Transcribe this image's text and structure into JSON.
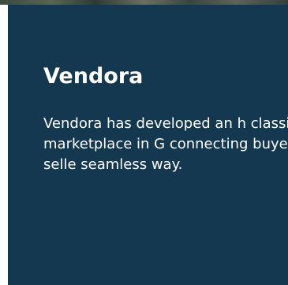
{
  "card": {
    "title": "Vendora",
    "description": "Vendora has developed an h classifieds marketplace in G connecting buyers and selle seamless way."
  },
  "colors": {
    "card_background": "#14384f",
    "text": "#ffffff"
  }
}
